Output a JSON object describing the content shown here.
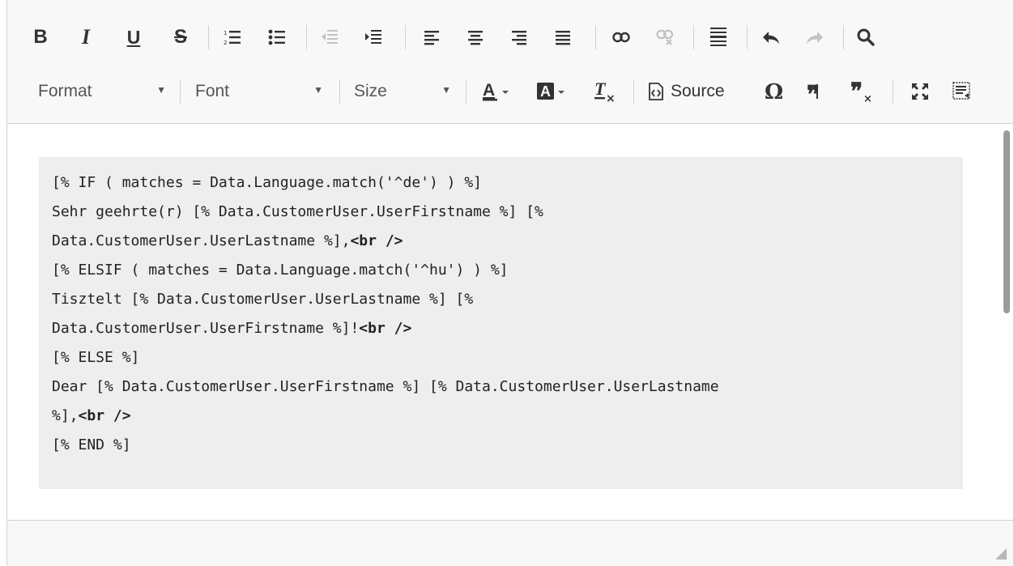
{
  "toolbar": {
    "row1": {
      "bold": "B",
      "italic": "I",
      "underline": "U",
      "strike": "S"
    },
    "row2": {
      "format_label": "Format",
      "font_label": "Font",
      "size_label": "Size",
      "source_label": "Source"
    }
  },
  "content": {
    "lines": [
      {
        "text": "[% IF ( matches = Data.Language.match('^de') ) %]"
      },
      {
        "text": "Sehr geehrte(r) [% Data.CustomerUser.UserFirstname %] [%"
      },
      {
        "pre": "Data.CustomerUser.UserLastname %],",
        "tag": "<br />"
      },
      {
        "text": "[% ELSIF ( matches = Data.Language.match('^hu') ) %]"
      },
      {
        "text": "Tisztelt [% Data.CustomerUser.UserLastname %] [%"
      },
      {
        "pre": "Data.CustomerUser.UserFirstname %]!",
        "tag": "<br />"
      },
      {
        "text": "[% ELSE %]"
      },
      {
        "text": "Dear [% Data.CustomerUser.UserFirstname %] [% Data.CustomerUser.UserLastname"
      },
      {
        "pre": "%],",
        "tag": "<br />"
      },
      {
        "text": "[% END %]"
      }
    ]
  },
  "icons": {
    "numbered_list": "numbered-list-icon",
    "bulleted_list": "bulleted-list-icon",
    "outdent": "outdent-icon",
    "indent": "indent-icon",
    "align_left": "align-left-icon",
    "align_center": "align-center-icon",
    "align_right": "align-right-icon",
    "justify": "justify-icon",
    "link": "link-icon",
    "unlink": "unlink-icon",
    "horizontal_line": "horizontal-line-icon",
    "undo": "undo-icon",
    "redo": "redo-icon",
    "find": "search-icon",
    "text_color": "text-color-icon",
    "background_color": "background-color-icon",
    "remove_format": "remove-format-icon",
    "source": "source-icon",
    "special_char": "omega-icon",
    "quote": "blockquote-icon",
    "remove_quote": "remove-blockquote-icon",
    "maximize": "maximize-icon",
    "show_blocks": "show-blocks-icon"
  },
  "colors": {
    "toolbar_bg": "#f8f8f8",
    "code_bg": "#eeeeee",
    "border": "#d1d1d1",
    "disabled_icon": "#c3c3c3"
  }
}
